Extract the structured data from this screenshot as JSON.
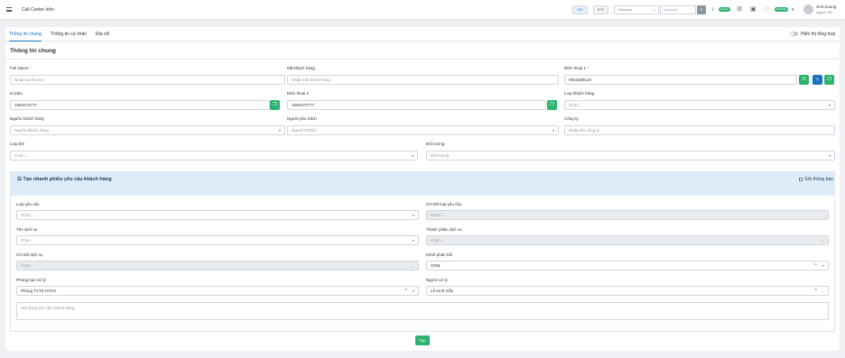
{
  "topbar": {
    "app_title": "Call Center Info",
    "pill1": "760",
    "pill2": "873",
    "category_placeholder": "Category",
    "keyword_placeholder": "Keyword",
    "badge1": "Online",
    "badge2": "ONLINE",
    "user_name": "vinh.truong",
    "user_role": "Agent 760"
  },
  "tabs": [
    "Thông tin chung",
    "Thông tin cá nhân",
    "Địa chỉ"
  ],
  "toggle_label": "Hiển thị tổng hợp",
  "section_title": "Thông tin chung",
  "form": {
    "full_name": {
      "label": "Full Name",
      "placeholder": "Nhập họ tên KH"
    },
    "ma_kh": {
      "label": "Mã khách hàng",
      "placeholder": "Nhập mã khách hàng"
    },
    "dt1": {
      "label": "Điện thoại 1",
      "value": "0931658119"
    },
    "id_zalo": {
      "label": "Id Zalo",
      "value": "1900272777"
    },
    "dt2": {
      "label": "Điện thoại 2",
      "value": "1900272777"
    },
    "loai_kh": {
      "label": "Loại khách hàng",
      "placeholder": "Chọn..."
    },
    "nguon_kh": {
      "label": "Nguồn khách hàng",
      "placeholder": "Nguồn khách hàng"
    },
    "nguoi_pt": {
      "label": "Người phụ trách",
      "placeholder": "Người P.trách"
    },
    "cong_ty": {
      "label": "Công ty",
      "placeholder": "Nhập tên công ty"
    },
    "loai_the": {
      "label": "Loại thẻ",
      "placeholder": "Chọn..."
    },
    "doi_tuong": {
      "label": "Đối tượng",
      "placeholder": "Đối tượng"
    }
  },
  "panel": {
    "title": "Tạo nhanh phiếu yêu cầu khách hàng",
    "send_label": "Gởi thông báo",
    "loai_yc": {
      "label": "Loại yêu cầu",
      "placeholder": "Chọn..."
    },
    "ct_loai_yc": {
      "label": "Chi tiết loại yêu cầu",
      "placeholder": "Chọn..."
    },
    "ten_dv": {
      "label": "Tên dịch vụ",
      "placeholder": "Chọn..."
    },
    "tp_dv": {
      "label": "Thành phần dịch vụ",
      "placeholder": "Chọn..."
    },
    "ct_dv": {
      "label": "Chi tiết dịch vụ",
      "placeholder": "Chọn..."
    },
    "kenh_ph": {
      "label": "Kênh phản hồi",
      "value": "CRM"
    },
    "phong_ban": {
      "label": "Phòng ban xử lý",
      "value": "Phòng TVTK-HTKH"
    },
    "nguoi_xl": {
      "label": "Người xử lý",
      "value": "Lê Kinh mẫu"
    },
    "content_placeholder": "Nội dung yêu cầu khách hàng"
  },
  "create_label": "Tạo"
}
